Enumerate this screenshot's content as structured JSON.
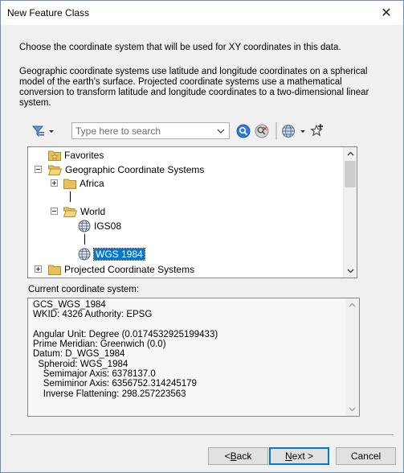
{
  "window": {
    "title": "New Feature Class",
    "close_glyph": "✕"
  },
  "intro_text": "Choose the coordinate system that will be used for XY coordinates in this data.",
  "description_text": "Geographic coordinate systems use latitude and longitude coordinates on a spherical model of the earth's surface. Projected coordinate systems use a mathematical conversion to transform latitude and longitude coordinates to a two-dimensional linear system.",
  "toolbar": {
    "filter_icon": "filter-icon",
    "search": {
      "placeholder": "Type here to search",
      "value": ""
    },
    "search_button_icon": "search-icon",
    "clear_search_icon": "clear-search-icon",
    "globe_icon": "globe-icon",
    "add_favorite_icon": "add-favorite-icon"
  },
  "tree": {
    "items": [
      {
        "label": "Favorites",
        "icon": "star-folder-icon",
        "expander": "none"
      },
      {
        "label": "Geographic Coordinate Systems",
        "icon": "open-folder-icon",
        "expander": "minus"
      },
      {
        "label": "Africa",
        "icon": "folder-icon",
        "expander": "plus"
      },
      {
        "label": "World",
        "icon": "open-folder-icon",
        "expander": "minus"
      },
      {
        "label": "IGS08",
        "icon": "globe-icon",
        "expander": "none"
      },
      {
        "label": "WGS 1984",
        "icon": "globe-icon",
        "expander": "none",
        "selected": true
      },
      {
        "label": "Projected Coordinate Systems",
        "icon": "folder-icon",
        "expander": "plus"
      }
    ]
  },
  "current_system": {
    "label": "Current coordinate system:",
    "lines": [
      "GCS_WGS_1984",
      "WKID: 4326 Authority: EPSG",
      "",
      "Angular Unit: Degree (0.0174532925199433)",
      "Prime Meridian: Greenwich (0.0)",
      "Datum: D_WGS_1984",
      "  Spheroid: WGS_1984",
      "    Semimajor Axis: 6378137.0",
      "    Semiminor Axis: 6356752.314245179",
      "    Inverse Flattening: 298.257223563"
    ]
  },
  "buttons": {
    "back_prefix": "< ",
    "back_mnemonic": "B",
    "back_rest": "ack",
    "next_mnemonic": "N",
    "next_rest": "ext >",
    "cancel": "Cancel"
  },
  "colors": {
    "selection": "#0078d7",
    "dialog_bg": "#f0f0f0",
    "folder": "#e8c15a"
  }
}
